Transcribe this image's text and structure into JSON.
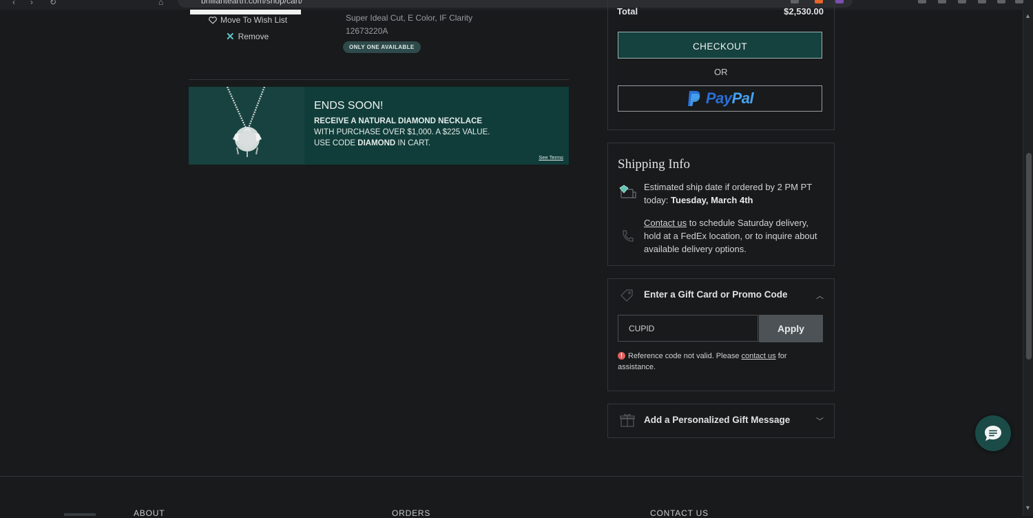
{
  "browser": {
    "url": "brilliantearth.com/shop/cart/"
  },
  "cart_item": {
    "wish_list_label": "Move To Wish List",
    "remove_label": "Remove",
    "spec": "Super Ideal Cut, E Color, IF Clarity",
    "sku": "12673220A",
    "badge": "ONLY ONE AVAILABLE"
  },
  "promo_banner": {
    "title": "ENDS SOON!",
    "line1": "RECEIVE A NATURAL DIAMOND NECKLACE",
    "line2": "WITH PURCHASE OVER $1,000. A $225 VALUE.",
    "line3_pre": "USE CODE ",
    "line3_code": "DIAMOND",
    "line3_post": " IN CART.",
    "terms": "See Terms"
  },
  "summary": {
    "total_label": "Total",
    "total_value": "$2,530.00",
    "checkout_label": "CHECKOUT",
    "or_label": "OR",
    "paypal_pay": "Pay",
    "paypal_pal": "Pal"
  },
  "shipping": {
    "title": "Shipping Info",
    "estimate_pre": "Estimated ship date if ordered by 2 PM PT today: ",
    "estimate_date": "Tuesday, March 4th",
    "contact_link": "Contact us",
    "contact_post": " to schedule Saturday delivery, hold at a FedEx location, or to inquire about available delivery options."
  },
  "promo_code": {
    "header": "Enter a Gift Card or Promo Code",
    "input_value": "CUPID",
    "apply_label": "Apply",
    "error_pre": "Reference code not valid. Please ",
    "error_link": "contact us",
    "error_post": " for assistance."
  },
  "gift_message": {
    "header": "Add a Personalized Gift Message"
  },
  "footer": {
    "col1": "ABOUT",
    "col2": "ORDERS",
    "col3": "CONTACT US"
  },
  "colors": {
    "accent_teal": "#15413e",
    "error": "#e0605f",
    "paypal_blue": "#2a6fd6"
  }
}
